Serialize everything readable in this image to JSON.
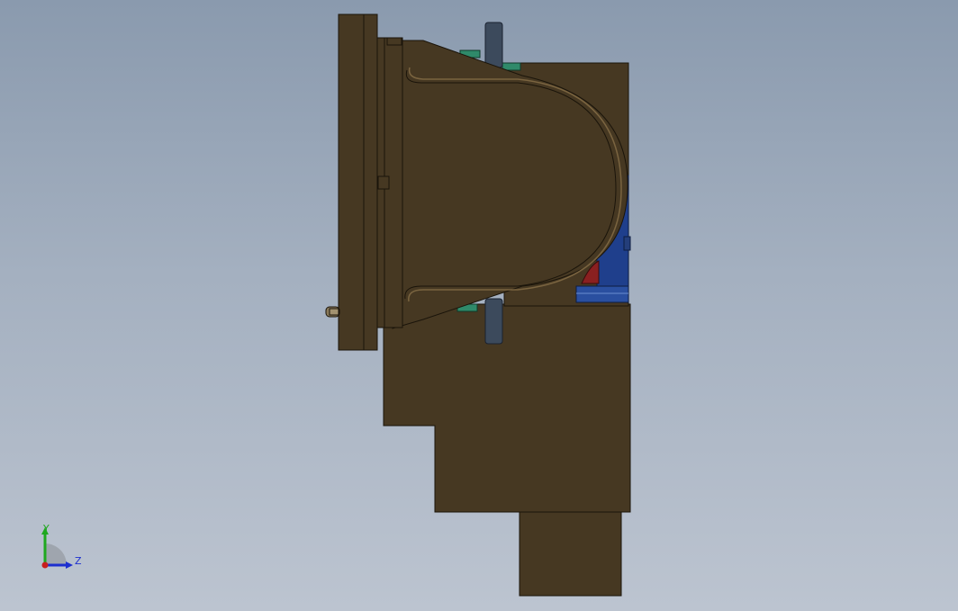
{
  "viewport": {
    "background_top": "#8a9aae",
    "background_bottom": "#bcc4d0"
  },
  "model": {
    "body_color": "#463822",
    "edge_color": "#1a140a",
    "accent_colors": {
      "steel": "#3c4a5c",
      "blue_component": "#1f3f8c",
      "red_component": "#8a2020",
      "green_component": "#2f8a6a"
    }
  },
  "triad": {
    "y_label": "Y",
    "z_label": "Z",
    "y_color": "#1fa81f",
    "z_color": "#1d2fcf",
    "x_color": "#c81e1e"
  }
}
